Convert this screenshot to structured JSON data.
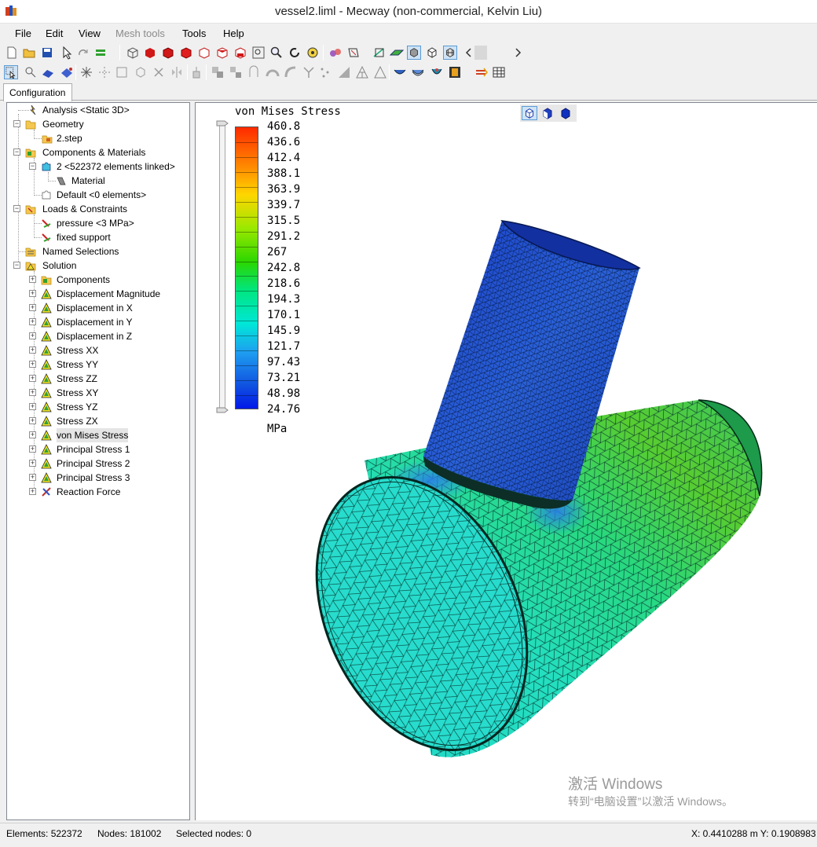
{
  "window": {
    "title": "vessel2.liml - Mecway (non-commercial, Kelvin Liu)"
  },
  "menu": {
    "file": "File",
    "edit": "Edit",
    "view": "View",
    "mesh_tools": "Mesh tools",
    "tools": "Tools",
    "help": "Help"
  },
  "tabs": {
    "configuration": "Configuration"
  },
  "tree": {
    "analysis": "Analysis <Static 3D>",
    "geometry": "Geometry",
    "step_file": "2.step",
    "components_materials": "Components & Materials",
    "component_2": "2 <522372 elements linked>",
    "material": "Material",
    "default_component": "Default <0 elements>",
    "loads_constraints": "Loads & Constraints",
    "pressure": "pressure <3 MPa>",
    "fixed_support": "fixed support",
    "named_selections": "Named Selections",
    "solution": "Solution",
    "results": [
      "Components",
      "Displacement Magnitude",
      "Displacement in X",
      "Displacement in Y",
      "Displacement in Z",
      "Stress XX",
      "Stress YY",
      "Stress ZZ",
      "Stress XY",
      "Stress YZ",
      "Stress ZX",
      "von Mises Stress",
      "Principal Stress 1",
      "Principal Stress 2",
      "Principal Stress 3",
      "Reaction Force"
    ],
    "selected": "von Mises Stress"
  },
  "legend": {
    "title": "von Mises Stress",
    "unit": "MPa",
    "values": [
      "460.8",
      "436.6",
      "412.4",
      "388.1",
      "363.9",
      "339.7",
      "315.5",
      "291.2",
      "267",
      "242.8",
      "218.6",
      "194.3",
      "170.1",
      "145.9",
      "121.7",
      "97.43",
      "73.21",
      "48.98",
      "24.76"
    ],
    "colors": {
      "max": "#ff2a00",
      "mid": "#2bd600",
      "min": "#0018e8"
    }
  },
  "watermark": {
    "line1": "激活 Windows",
    "line2": "转到“电脑设置”以激活 Windows。"
  },
  "status": {
    "elements": "Elements: 522372",
    "nodes": "Nodes: 181002",
    "selected_nodes": "Selected nodes: 0",
    "coords": "X: 0.4410288 m Y: 0.1908983"
  }
}
